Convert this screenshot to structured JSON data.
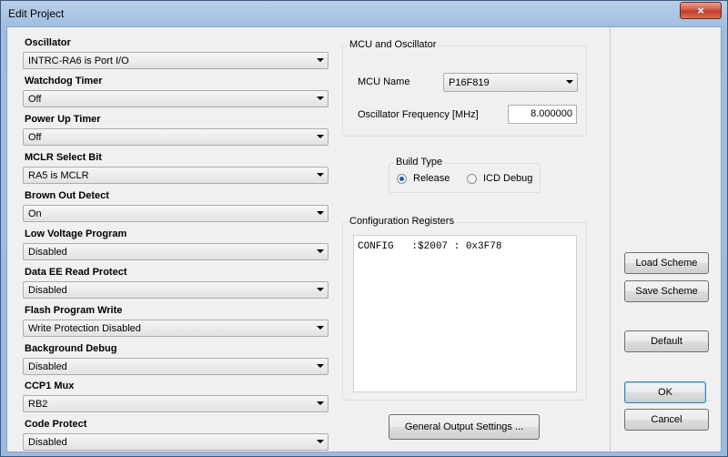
{
  "window": {
    "title": "Edit Project",
    "close_glyph": "×"
  },
  "left": {
    "items": [
      {
        "label": "Oscillator",
        "value": "INTRC-RA6 is Port I/O"
      },
      {
        "label": "Watchdog Timer",
        "value": "Off"
      },
      {
        "label": "Power Up Timer",
        "value": "Off"
      },
      {
        "label": "MCLR Select Bit",
        "value": "RA5 is MCLR"
      },
      {
        "label": "Brown Out Detect",
        "value": "On"
      },
      {
        "label": "Low Voltage Program",
        "value": "Disabled"
      },
      {
        "label": "Data EE Read Protect",
        "value": "Disabled"
      },
      {
        "label": "Flash Program Write",
        "value": "Write Protection Disabled"
      },
      {
        "label": "Background Debug",
        "value": "Disabled"
      },
      {
        "label": "CCP1 Mux",
        "value": "RB2"
      },
      {
        "label": "Code Protect",
        "value": "Disabled"
      }
    ]
  },
  "mcu": {
    "group_title": "MCU and Oscillator",
    "name_label": "MCU Name",
    "name_value": "P16F819",
    "freq_label": "Oscillator Frequency [MHz]",
    "freq_value": "8.000000"
  },
  "build": {
    "group_title": "Build Type",
    "release_label": "Release",
    "debug_label": "ICD Debug",
    "selected": "Release"
  },
  "config": {
    "group_title": "Configuration Registers",
    "text": "CONFIG   :$2007 : 0x3F78"
  },
  "buttons": {
    "general_output": "General Output Settings ...",
    "load_scheme": "Load Scheme",
    "save_scheme": "Save Scheme",
    "default": "Default",
    "ok": "OK",
    "cancel": "Cancel"
  }
}
